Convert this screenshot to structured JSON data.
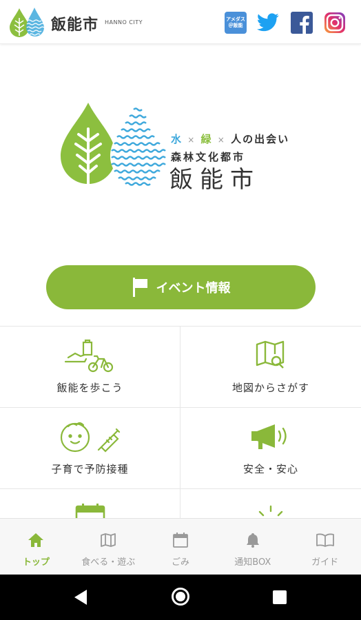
{
  "header": {
    "title": "飯能市",
    "subtitle": "HANNO CITY",
    "amedas_line1": "アメダス",
    "amedas_line2": "＠飯能",
    "social": [
      "amedas-icon",
      "twitter-icon",
      "facebook-icon",
      "instagram-icon"
    ]
  },
  "hero": {
    "part1": "水",
    "sep1": "×",
    "part2": "緑",
    "sep2": "×",
    "part3": "人の出会い",
    "line2": "森林文化都市",
    "line3": "飯能市"
  },
  "event_button": {
    "label": "イベント情報",
    "icon": "flag-icon"
  },
  "menu": [
    {
      "label": "飯能を歩こう",
      "icon": "walking-bicycle-icon"
    },
    {
      "label": "地図からさがす",
      "icon": "map-search-icon"
    },
    {
      "label": "子育で予防接種",
      "icon": "baby-syringe-icon"
    },
    {
      "label": "安全・安心",
      "icon": "megaphone-icon"
    },
    {
      "label": "",
      "icon": "calendar-icon"
    },
    {
      "label": "",
      "icon": "sunrise-icon"
    }
  ],
  "tabs": [
    {
      "label": "トップ",
      "icon": "home-icon",
      "active": true
    },
    {
      "label": "食べる・遊ぶ",
      "icon": "map-icon",
      "active": false
    },
    {
      "label": "ごみ",
      "icon": "calendar-icon",
      "active": false
    },
    {
      "label": "通知BOX",
      "icon": "bell-icon",
      "active": false
    },
    {
      "label": "ガイド",
      "icon": "book-icon",
      "active": false
    }
  ],
  "colors": {
    "accent_green": "#8ab83a",
    "water_blue": "#3fa9dc",
    "twitter": "#1da1f2",
    "facebook": "#3b5998"
  }
}
